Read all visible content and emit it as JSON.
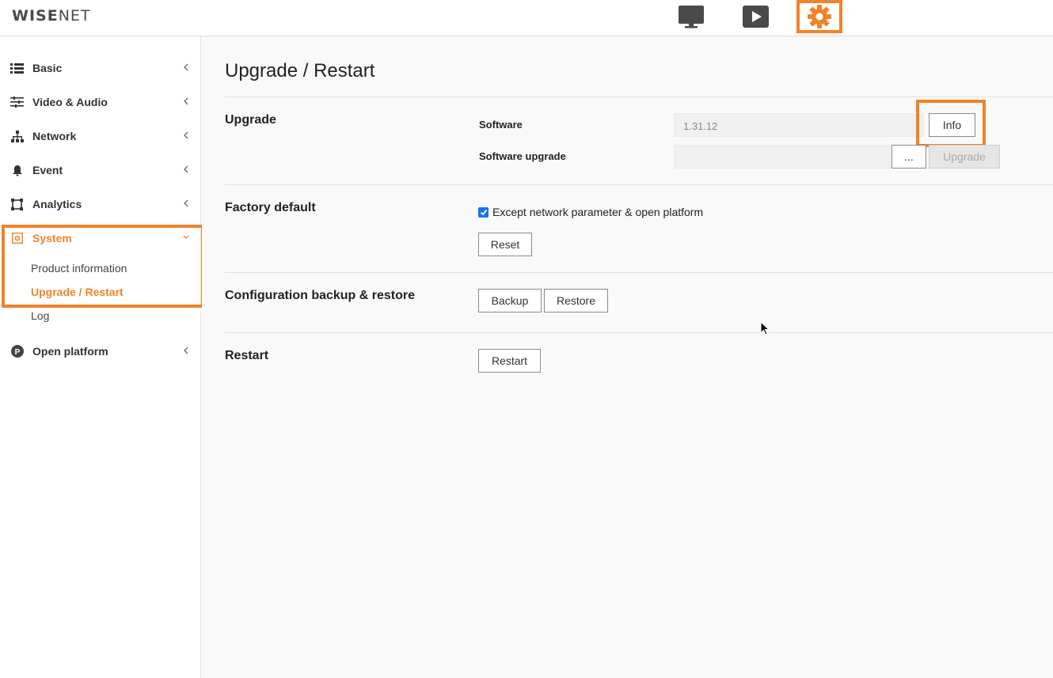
{
  "header": {
    "logo_bold": "WISE",
    "logo_thin": "NET",
    "icons": [
      "monitor-icon",
      "play-icon",
      "settings-icon"
    ]
  },
  "sidebar": {
    "items": [
      {
        "label": "Basic",
        "icon": "list-icon"
      },
      {
        "label": "Video & Audio",
        "icon": "sliders-icon"
      },
      {
        "label": "Network",
        "icon": "network-icon"
      },
      {
        "label": "Event",
        "icon": "bell-icon"
      },
      {
        "label": "Analytics",
        "icon": "analytics-icon"
      },
      {
        "label": "System",
        "icon": "system-icon",
        "expanded": true
      },
      {
        "label": "Open platform",
        "icon": "open-platform-icon",
        "badge": "P"
      }
    ],
    "system_sub": [
      {
        "label": "Product information"
      },
      {
        "label": "Upgrade / Restart",
        "active": true
      },
      {
        "label": "Log"
      }
    ]
  },
  "main": {
    "title": "Upgrade / Restart",
    "upgrade": {
      "title": "Upgrade",
      "software_label": "Software",
      "software_value": "1.31.12",
      "info_button": "Info",
      "upgrade_label": "Software upgrade",
      "browse_button": "...",
      "upgrade_button": "Upgrade"
    },
    "factory": {
      "title": "Factory default",
      "checkbox_label": "Except network parameter & open platform",
      "checkbox_checked": true,
      "reset_button": "Reset"
    },
    "config": {
      "title": "Configuration backup & restore",
      "backup_button": "Backup",
      "restore_button": "Restore"
    },
    "restart": {
      "title": "Restart",
      "restart_button": "Restart"
    }
  },
  "colors": {
    "accent": "#f0832a",
    "checkbox": "#1a73e8"
  }
}
